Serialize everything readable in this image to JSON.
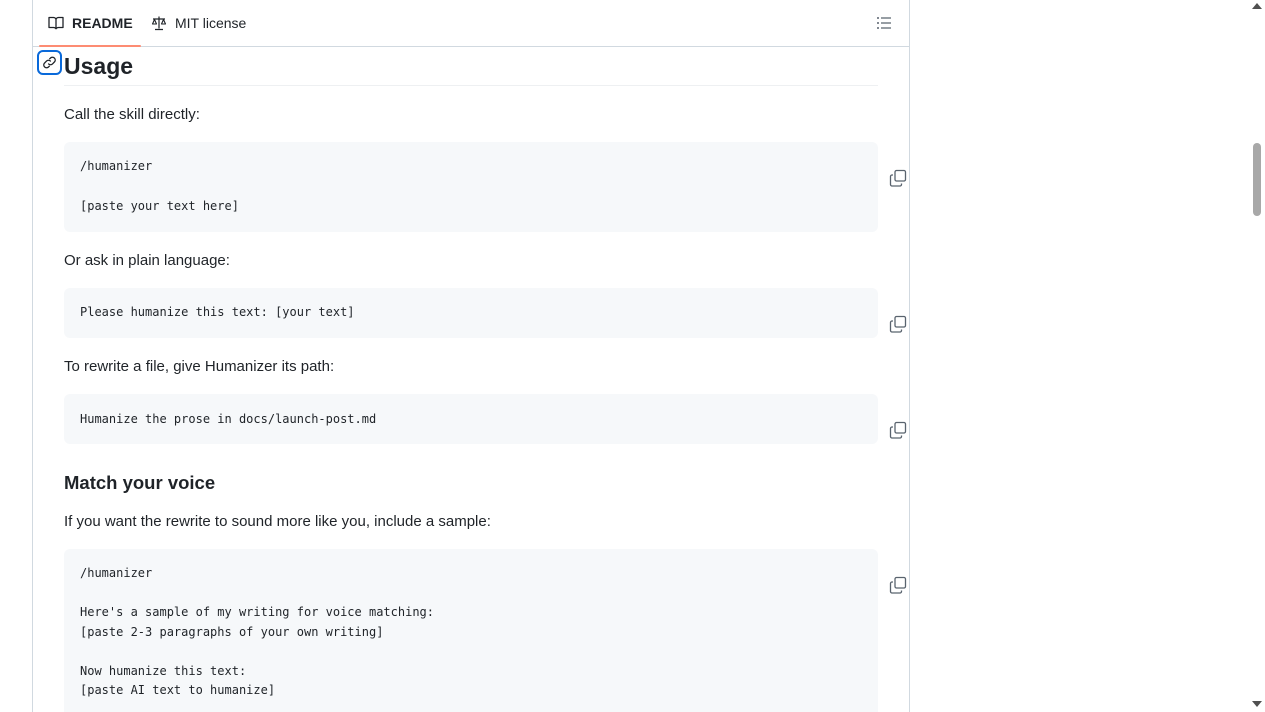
{
  "tabs": {
    "readme": "README",
    "license": "MIT license"
  },
  "usage": {
    "heading": "Usage",
    "intro": "Call the skill directly:",
    "block1": [
      "/humanizer",
      "[paste your text here]"
    ],
    "plain_intro": "Or ask in plain language:",
    "block2": [
      "Please humanize this text: [your text]"
    ],
    "file_intro": "To rewrite a file, give Humanizer its path:",
    "block3": [
      "Humanize the prose in docs/launch-post.md"
    ]
  },
  "voice": {
    "heading": "Match your voice",
    "intro": "If you want the rewrite to sound more like you, include a sample:",
    "block4": [
      "/humanizer",
      "Here's a sample of my writing for voice matching:",
      "[paste 2-3 paragraphs of your own writing]",
      "Now humanize this text:",
      "[paste AI text to humanize]"
    ]
  },
  "icons": {
    "readme": "book-icon",
    "license": "law-icon",
    "outline": "list-unordered-icon",
    "anchor": "link-icon",
    "copy": "copy-icon"
  },
  "colors": {
    "tab_underline": "#fd8c73",
    "link_focus": "#0969da",
    "code_bg": "#f6f8fa"
  }
}
